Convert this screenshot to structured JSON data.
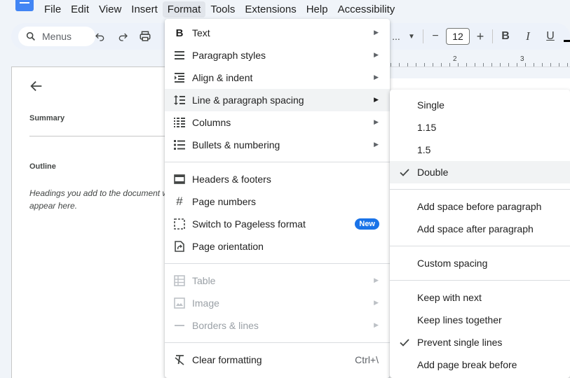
{
  "menubar": {
    "items": [
      {
        "label": "File"
      },
      {
        "label": "Edit"
      },
      {
        "label": "View"
      },
      {
        "label": "Insert"
      },
      {
        "label": "Format"
      },
      {
        "label": "Tools"
      },
      {
        "label": "Extensions"
      },
      {
        "label": "Help"
      },
      {
        "label": "Accessibility"
      }
    ],
    "active": "Format"
  },
  "toolbar": {
    "search_placeholder": "Menus",
    "font_size": "12",
    "bold": "B",
    "italic": "I",
    "underline": "U",
    "minus": "−",
    "plus": "+"
  },
  "ruler": {
    "marks": [
      "2",
      "3"
    ]
  },
  "outline": {
    "summary_label": "Summary",
    "outline_label": "Outline",
    "hint": "Headings you add to the document will appear here."
  },
  "format_menu": {
    "group1": [
      {
        "label": "Text",
        "icon": "bold-icon",
        "submenu": true
      },
      {
        "label": "Paragraph styles",
        "icon": "paragraph-styles-icon",
        "submenu": true
      },
      {
        "label": "Align & indent",
        "icon": "indent-icon",
        "submenu": true
      },
      {
        "label": "Line & paragraph spacing",
        "icon": "line-spacing-icon",
        "submenu": true,
        "highlighted": true
      },
      {
        "label": "Columns",
        "icon": "columns-icon",
        "submenu": true
      },
      {
        "label": "Bullets & numbering",
        "icon": "bullets-icon",
        "submenu": true
      }
    ],
    "group2": [
      {
        "label": "Headers & footers",
        "icon": "header-footer-icon"
      },
      {
        "label": "Page numbers",
        "icon": "hash-icon"
      },
      {
        "label": "Switch to Pageless format",
        "icon": "pageless-icon",
        "badge": "New"
      },
      {
        "label": "Page orientation",
        "icon": "page-orientation-icon"
      }
    ],
    "group3": [
      {
        "label": "Table",
        "icon": "table-icon",
        "submenu": true,
        "disabled": true
      },
      {
        "label": "Image",
        "icon": "image-icon",
        "submenu": true,
        "disabled": true
      },
      {
        "label": "Borders & lines",
        "icon": "borders-icon",
        "submenu": true,
        "disabled": true
      }
    ],
    "group4": [
      {
        "label": "Clear formatting",
        "icon": "clear-format-icon",
        "shortcut": "Ctrl+\\"
      }
    ]
  },
  "spacing_menu": {
    "group1": [
      {
        "label": "Single",
        "checked": false
      },
      {
        "label": "1.15",
        "checked": false
      },
      {
        "label": "1.5",
        "checked": false
      },
      {
        "label": "Double",
        "checked": true
      }
    ],
    "group2": [
      {
        "label": "Add space before paragraph"
      },
      {
        "label": "Add space after paragraph"
      }
    ],
    "group3": [
      {
        "label": "Custom spacing"
      }
    ],
    "group4": [
      {
        "label": "Keep with next",
        "checked": false
      },
      {
        "label": "Keep lines together",
        "checked": false
      },
      {
        "label": "Prevent single lines",
        "checked": true
      },
      {
        "label": "Add page break before",
        "checked": false
      }
    ]
  },
  "colors": {
    "accent": "#1a73e8",
    "menu_highlight": "#f1f3f4",
    "badge": "#1a73e8"
  }
}
